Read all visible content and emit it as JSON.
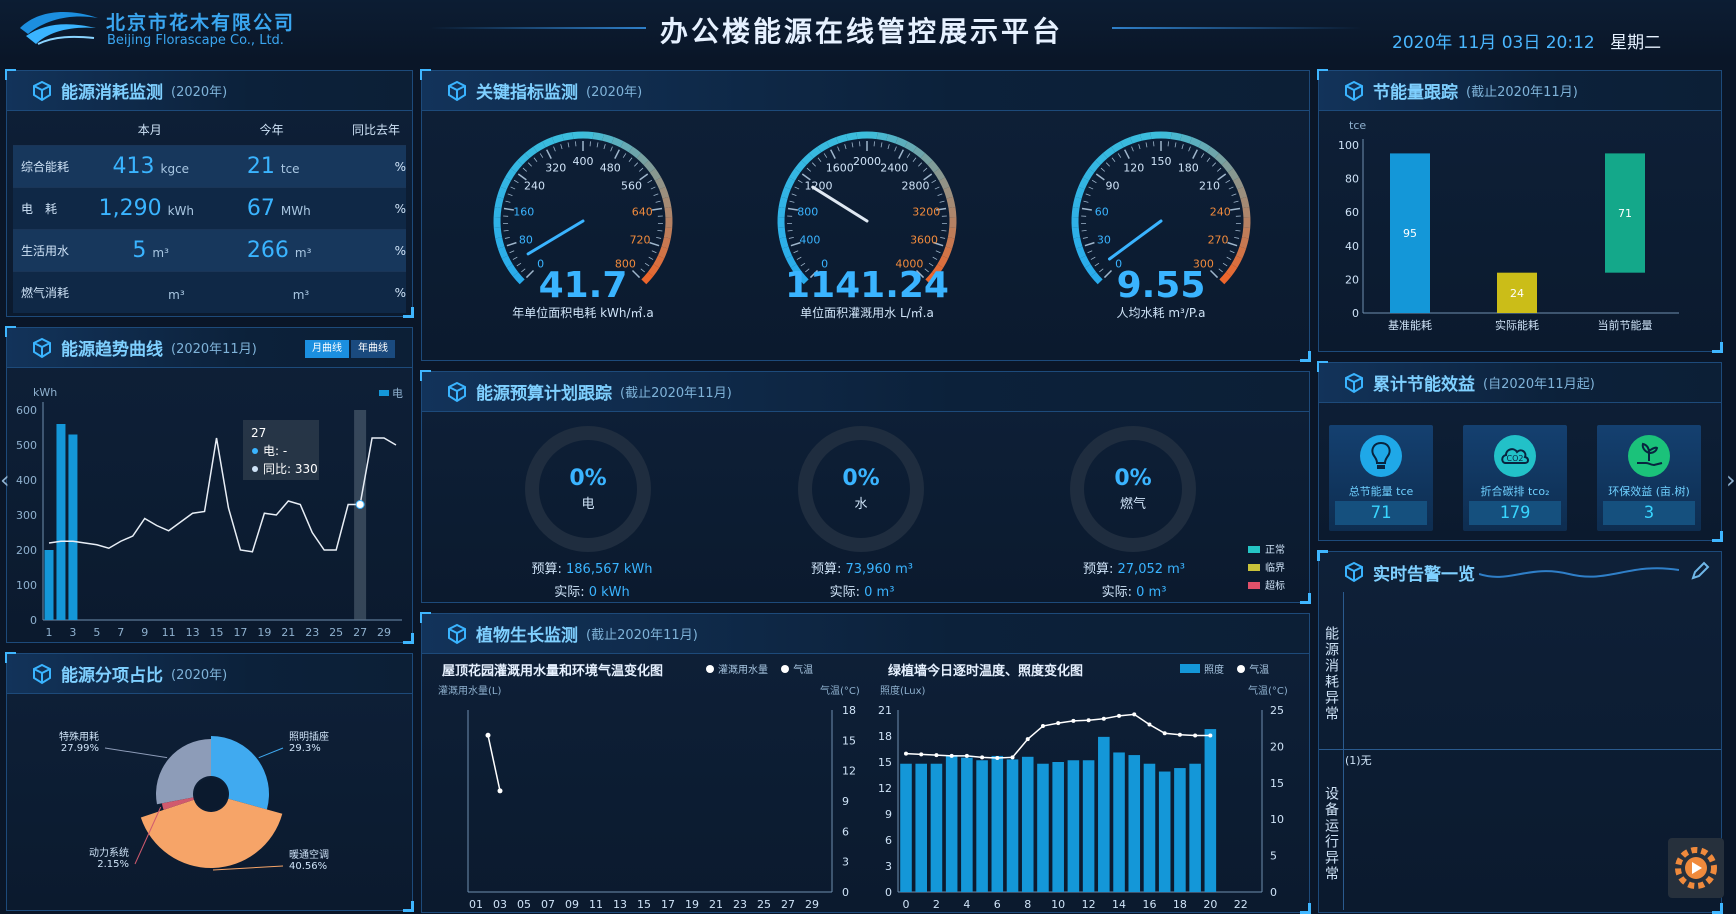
{
  "header": {
    "company_cn": "北京市花木有限公司",
    "company_en": "Beijing Florascape Co., Ltd.",
    "title": "办公楼能源在线管控展示平台",
    "datetime": "2020年 11月 03日 20:12",
    "weekday": "星期二"
  },
  "energy_consumption": {
    "title": "能源消耗监测",
    "subtitle": "(2020年)",
    "col_month": "本月",
    "col_year": "今年",
    "col_yoy": "同比去年",
    "rows": [
      {
        "name": "综合能耗",
        "month_value": "413",
        "month_unit": "kgce",
        "year_value": "21",
        "year_unit": "tce",
        "yoy": "%"
      },
      {
        "name": "电　耗",
        "month_value": "1,290",
        "month_unit": "kWh",
        "year_value": "67",
        "year_unit": "MWh",
        "yoy": "%"
      },
      {
        "name": "生活用水",
        "month_value": "5",
        "month_unit": "m³",
        "year_value": "266",
        "year_unit": "m³",
        "yoy": "%"
      },
      {
        "name": "燃气消耗",
        "month_value": "",
        "month_unit": "m³",
        "year_value": "",
        "year_unit": "m³",
        "yoy": "%"
      }
    ]
  },
  "trend": {
    "title": "能源趋势曲线",
    "subtitle": "(2020年11月)",
    "tab_month": "月曲线",
    "tab_year": "年曲线",
    "legend": "电",
    "unit": "kWh",
    "tooltip_day": "27",
    "tooltip_elec": "电: -",
    "tooltip_yoy": "同比: 330",
    "left_arrow": "‹",
    "right_arrow": "›"
  },
  "share": {
    "title": "能源分项占比",
    "subtitle": "(2020年)",
    "labels": [
      {
        "name": "特殊用耗",
        "pct": "27.99%"
      },
      {
        "name": "照明插座",
        "pct": "29.3%"
      },
      {
        "name": "动力系统",
        "pct": "2.15%"
      },
      {
        "name": "暖通空调",
        "pct": "40.56%"
      }
    ]
  },
  "kpi": {
    "title": "关键指标监测",
    "subtitle": "(2020年)",
    "gauges": [
      {
        "value": "41.7",
        "label": "年单位面积电耗 kWh/㎡.a",
        "ticks": [
          "0",
          "80",
          "160",
          "240",
          "320",
          "400",
          "480",
          "560",
          "640",
          "720",
          "800"
        ]
      },
      {
        "value": "1141.24",
        "label": "单位面积灌溉用水 L/㎡.a",
        "ticks": [
          "0",
          "400",
          "800",
          "1200",
          "1600",
          "2000",
          "2400",
          "2800",
          "3200",
          "3600",
          "4000"
        ]
      },
      {
        "value": "9.55",
        "label": "人均水耗 m³/P.a",
        "ticks": [
          "0",
          "30",
          "60",
          "90",
          "120",
          "150",
          "180",
          "210",
          "240",
          "270",
          "300"
        ]
      }
    ]
  },
  "budget": {
    "title": "能源预算计划跟踪",
    "subtitle": "(截止2020年11月)",
    "items": [
      {
        "pct": "0%",
        "name": "电",
        "budget_label": "预算:",
        "budget": "186,567 kWh",
        "actual_label": "实际:",
        "actual": "0 kWh"
      },
      {
        "pct": "0%",
        "name": "水",
        "budget_label": "预算:",
        "budget": "73,960 m³",
        "actual_label": "实际:",
        "actual": "0 m³"
      },
      {
        "pct": "0%",
        "name": "燃气",
        "budget_label": "预算:",
        "budget": "27,052 m³",
        "actual_label": "实际:",
        "actual": "0 m³"
      }
    ],
    "legend": [
      {
        "name": "正常",
        "color": "#25c5c5"
      },
      {
        "name": "临界",
        "color": "#c9c23a"
      },
      {
        "name": "超标",
        "color": "#e0506a"
      }
    ]
  },
  "plant": {
    "title": "植物生长监测",
    "subtitle": "(截止2020年11月)",
    "left_title": "屋顶花园灌溉用水量和环境气温变化图",
    "left_legend1": "灌溉用水量",
    "left_legend2": "气温",
    "left_yaxis": "灌溉用水量(L)",
    "left_y2axis": "气温(°C)",
    "right_title": "绿植墙今日逐时温度、照度变化图",
    "right_legend1": "照度",
    "right_legend2": "气温",
    "right_yaxis": "照度(Lux)",
    "right_y2axis": "气温(°C)"
  },
  "saving": {
    "title": "节能量跟踪",
    "subtitle": "(截止2020年11月)",
    "unit": "tce"
  },
  "benefit": {
    "title": "累计节能效益",
    "subtitle": "(自2020年11月起)",
    "items": [
      {
        "label": "总节能量 tce",
        "value": "71"
      },
      {
        "label": "折合碳排 tco₂",
        "value": "179"
      },
      {
        "label": "环保效益 (亩.树)",
        "value": "3"
      }
    ]
  },
  "alarm": {
    "title": "实时告警一览",
    "section1": "能源消耗异常",
    "section2": "设备运行异常",
    "none": "(1)无"
  },
  "colors": {
    "accent": "#3ab4ff",
    "bar_blue": "#1497d8",
    "bar_yellow": "#cbbd18",
    "bar_green": "#14a88a",
    "pie_blue": "#40aaf0",
    "pie_orange": "#f6a468",
    "pie_grey": "#8d9cb8"
  },
  "chart_data": [
    {
      "type": "bar",
      "id": "trend",
      "ylabel": "kWh",
      "ylim": [
        0,
        600
      ],
      "x": [
        1,
        2,
        3,
        4,
        5,
        6,
        7,
        8,
        9,
        10,
        11,
        12,
        13,
        14,
        15,
        16,
        17,
        18,
        19,
        20,
        21,
        22,
        23,
        24,
        25,
        26,
        27,
        28,
        29,
        30
      ],
      "xticks": [
        "1",
        "3",
        "5",
        "7",
        "9",
        "11",
        "13",
        "15",
        "17",
        "19",
        "21",
        "23",
        "25",
        "27",
        "29"
      ],
      "yticks": [
        "0",
        "100",
        "200",
        "300",
        "400",
        "500",
        "600"
      ],
      "series": [
        {
          "name": "电",
          "kind": "bar",
          "values": [
            200,
            560,
            530,
            0,
            0,
            0,
            0,
            0,
            0,
            0,
            0,
            0,
            0,
            0,
            0,
            0,
            0,
            0,
            0,
            0,
            0,
            0,
            0,
            0,
            0,
            0,
            0,
            0,
            0,
            0
          ]
        },
        {
          "name": "同比",
          "kind": "line",
          "values": [
            220,
            225,
            225,
            220,
            215,
            205,
            225,
            240,
            290,
            270,
            255,
            280,
            305,
            310,
            520,
            320,
            200,
            195,
            305,
            300,
            340,
            330,
            250,
            200,
            200,
            330,
            330,
            520,
            520,
            500
          ]
        }
      ]
    },
    {
      "type": "pie",
      "id": "share",
      "categories": [
        "特殊用耗",
        "照明插座",
        "动力系统",
        "暖通空调"
      ],
      "values": [
        27.99,
        29.3,
        2.15,
        40.56
      ]
    },
    {
      "type": "bar",
      "id": "saving",
      "ylabel": "tce",
      "ylim": [
        0,
        100
      ],
      "yticks": [
        "0",
        "20",
        "40",
        "60",
        "80",
        "100"
      ],
      "categories": [
        "基准能耗",
        "实际能耗",
        "当前节能量"
      ],
      "values": [
        95,
        24,
        71
      ]
    },
    {
      "type": "line",
      "id": "irrigation",
      "xticks": [
        "01",
        "03",
        "05",
        "07",
        "09",
        "11",
        "13",
        "15",
        "17",
        "19",
        "21",
        "23",
        "25",
        "27",
        "29"
      ],
      "yticks_right": [
        "0",
        "3",
        "6",
        "9",
        "12",
        "15",
        "18"
      ],
      "series": [
        {
          "name": "气温",
          "x": [
            "02",
            "03"
          ],
          "values": [
            15.5,
            10
          ]
        }
      ],
      "ylim_right": [
        0,
        18
      ]
    },
    {
      "type": "bar",
      "id": "greenwall",
      "xticks": [
        "0",
        "2",
        "4",
        "6",
        "8",
        "10",
        "12",
        "14",
        "16",
        "18",
        "20",
        "22"
      ],
      "yticks_left": [
        "0",
        "3",
        "6",
        "9",
        "12",
        "15",
        "18",
        "21"
      ],
      "yticks_right": [
        "0",
        "5",
        "10",
        "15",
        "20",
        "25"
      ],
      "ylim_left": [
        0,
        21
      ],
      "ylim_right": [
        0,
        25
      ],
      "series": [
        {
          "name": "照度",
          "kind": "bar",
          "values": [
            14.8,
            14.8,
            14.8,
            15.8,
            15.5,
            15.2,
            15.7,
            15.3,
            15.6,
            14.8,
            15,
            15.2,
            15.2,
            17.9,
            16.1,
            15.8,
            14.8,
            13.9,
            14.3,
            14.8,
            18.8
          ]
        },
        {
          "name": "气温",
          "kind": "line",
          "values": [
            19,
            18.9,
            18.8,
            18.7,
            18.7,
            18.5,
            18.4,
            18.5,
            21,
            22.8,
            23.2,
            23.5,
            23.6,
            23.8,
            24.2,
            24.4,
            23,
            21.8,
            21.6,
            21.5,
            21.5
          ]
        }
      ]
    }
  ]
}
